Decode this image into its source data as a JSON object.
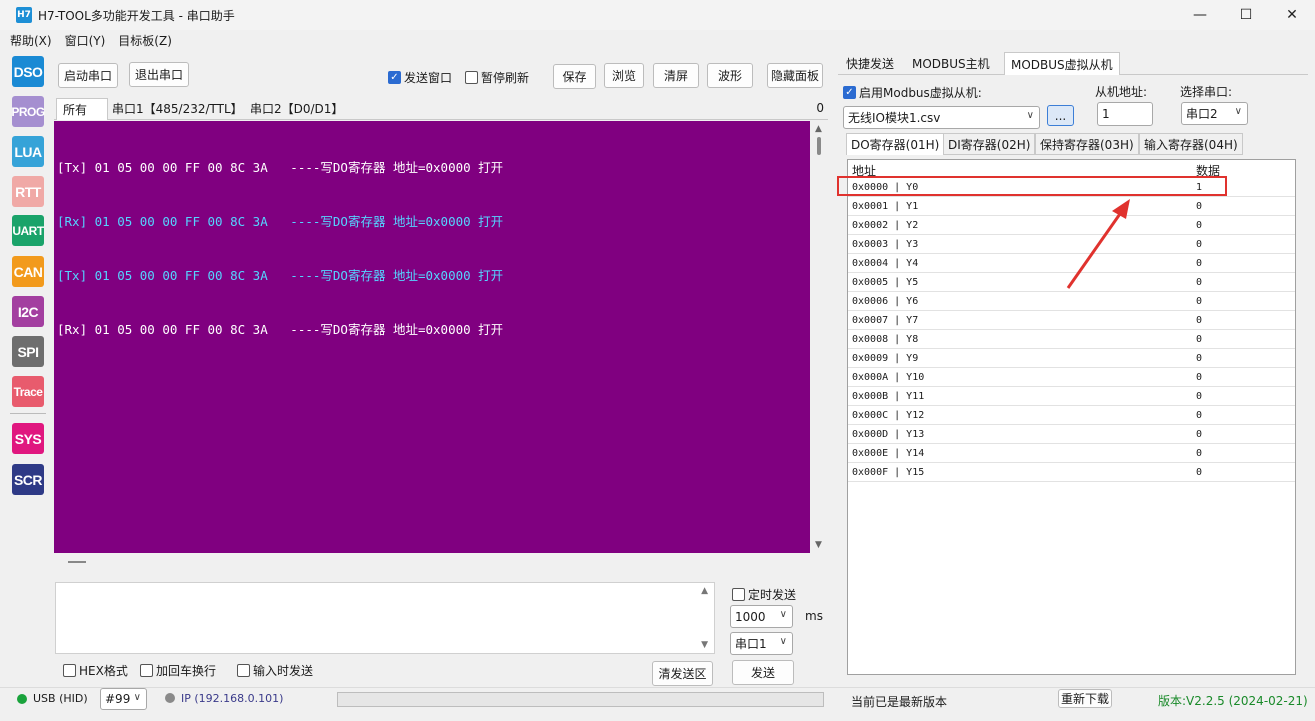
{
  "app": {
    "icon_label": "H7",
    "title": "H7-TOOL多功能开发工具 - 串口助手"
  },
  "window_controls": {
    "minimize": "—",
    "maximize": "☐",
    "close": "✕"
  },
  "menu": [
    "帮助(X)",
    "窗口(Y)",
    "目标板(Z)"
  ],
  "sidebar": [
    {
      "label": "DSO",
      "color": "#1a8ad4"
    },
    {
      "label": "PROG",
      "color": "#a58fd0"
    },
    {
      "label": "LUA",
      "color": "#36a3d8"
    },
    {
      "label": "RTT",
      "color": "#f0a9a6"
    },
    {
      "label": "UART",
      "color": "#1aa36a"
    },
    {
      "label": "CAN",
      "color": "#f29a1c"
    },
    {
      "label": "I2C",
      "color": "#a33fa0"
    },
    {
      "label": "SPI",
      "color": "#6e6e6e"
    },
    {
      "label": "Trace",
      "color": "#e85b6d"
    },
    {
      "label": "SYS",
      "color": "#e0177f"
    },
    {
      "label": "SCR",
      "color": "#2e3a86"
    }
  ],
  "toolbar": {
    "open_port": "启动串口",
    "close_port": "退出串口",
    "send_window": "发送窗口",
    "send_window_checked": true,
    "pause_refresh": "暂停刷新",
    "pause_refresh_checked": false,
    "save": "保存",
    "browse": "浏览",
    "clear": "清屏",
    "wave": "波形",
    "hide_panel": "隐藏面板"
  },
  "log_tabs": {
    "items": [
      "所有",
      "串口1【485/232/TTL】",
      "串口2【D0/D1】"
    ],
    "count": "0"
  },
  "terminal": {
    "lines": [
      {
        "text": "[Tx] 01 05 00 00 FF 00 8C 3A   ----写DO寄存器 地址=0x0000 打开",
        "kind": "tx"
      },
      {
        "text": "[Rx] 01 05 00 00 FF 00 8C 3A   ----写DO寄存器 地址=0x0000 打开",
        "kind": "rx"
      },
      {
        "text": "[Tx] 01 05 00 00 FF 00 8C 3A   ----写DO寄存器 地址=0x0000 打开",
        "kind": "tx2"
      },
      {
        "text": "[Rx] 01 05 00 00 FF 00 8C 3A   ----写DO寄存器 地址=0x0000 打开",
        "kind": "rx2"
      }
    ],
    "colors": {
      "background": "#800080",
      "tx": "#ffffff",
      "rx": "#55d4ff"
    }
  },
  "send": {
    "timed_send": "定时发送",
    "timed_send_checked": false,
    "interval": "1000",
    "unit": "ms",
    "port": "串口1",
    "hex_format": "HEX格式",
    "add_newline": "加回车换行",
    "send_on_input": "输入时发送",
    "clear_send": "清发送区",
    "send": "发送"
  },
  "status": {
    "usb": "USB (HID)",
    "device": "#99",
    "ip": "IP (192.168.0.101)",
    "update_msg": "当前已是最新版本",
    "redownload": "重新下载",
    "version": "版本:V2.2.5 (2024-02-21)"
  },
  "right": {
    "tabs": [
      "快捷发送",
      "MODBUS主机",
      "MODBUS虚拟从机"
    ],
    "enable_slave": "启用Modbus虚拟从机:",
    "enable_checked": true,
    "file": "无线IO模块1.csv",
    "browse_btn": "...",
    "slave_addr_label": "从机地址:",
    "slave_addr": "1",
    "port_label": "选择串口:",
    "port": "串口2",
    "sub_tabs": [
      "DO寄存器(01H)",
      "DI寄存器(02H)",
      "保持寄存器(03H)",
      "输入寄存器(04H)"
    ],
    "grid_header": {
      "addr": "地址",
      "data": "数据"
    },
    "rows": [
      {
        "addr": "0x0000 | Y0",
        "val": "1"
      },
      {
        "addr": "0x0001 | Y1",
        "val": "0"
      },
      {
        "addr": "0x0002 | Y2",
        "val": "0"
      },
      {
        "addr": "0x0003 | Y3",
        "val": "0"
      },
      {
        "addr": "0x0004 | Y4",
        "val": "0"
      },
      {
        "addr": "0x0005 | Y5",
        "val": "0"
      },
      {
        "addr": "0x0006 | Y6",
        "val": "0"
      },
      {
        "addr": "0x0007 | Y7",
        "val": "0"
      },
      {
        "addr": "0x0008 | Y8",
        "val": "0"
      },
      {
        "addr": "0x0009 | Y9",
        "val": "0"
      },
      {
        "addr": "0x000A | Y10",
        "val": "0"
      },
      {
        "addr": "0x000B | Y11",
        "val": "0"
      },
      {
        "addr": "0x000C | Y12",
        "val": "0"
      },
      {
        "addr": "0x000D | Y13",
        "val": "0"
      },
      {
        "addr": "0x000E | Y14",
        "val": "0"
      },
      {
        "addr": "0x000F | Y15",
        "val": "0"
      }
    ],
    "highlight_color": "#e0322e"
  }
}
